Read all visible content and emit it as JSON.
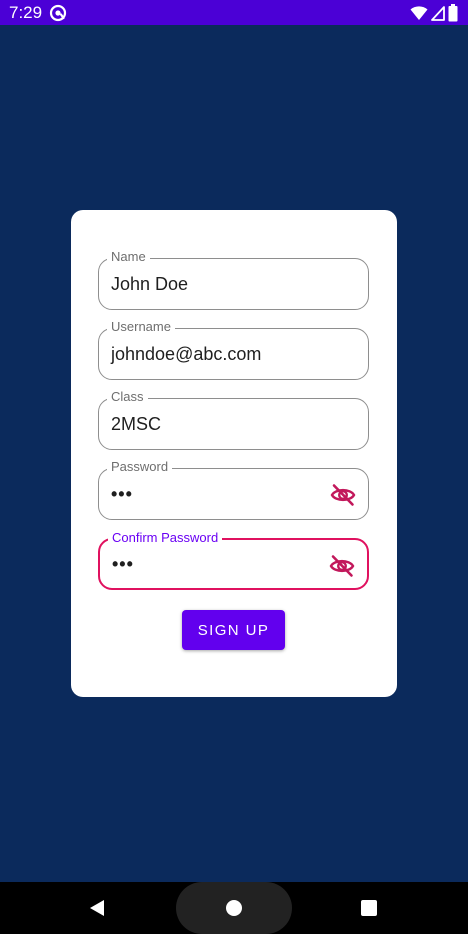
{
  "status_bar": {
    "time": "7:29",
    "app_icon": "at-sync-icon",
    "icons": [
      "wifi-icon",
      "signal-icon",
      "battery-icon"
    ]
  },
  "form": {
    "fields": [
      {
        "label": "Name",
        "value": "John Doe"
      },
      {
        "label": "Username",
        "value": "johndoe@abc.com"
      },
      {
        "label": "Class",
        "value": "2MSC"
      },
      {
        "label": "Password",
        "value": "•••",
        "icon": "visibility-off-icon"
      },
      {
        "label": "Confirm Password",
        "value": "•••",
        "icon": "visibility-off-icon"
      }
    ],
    "submit_label": "SIGN UP"
  },
  "colors": {
    "background": "#0b2a5c",
    "status_bar": "#4b00d6",
    "accent": "#6200ee",
    "error": "#e0115f"
  },
  "nav_bar": {
    "icons": [
      "back-icon",
      "home-icon",
      "recents-icon"
    ]
  }
}
